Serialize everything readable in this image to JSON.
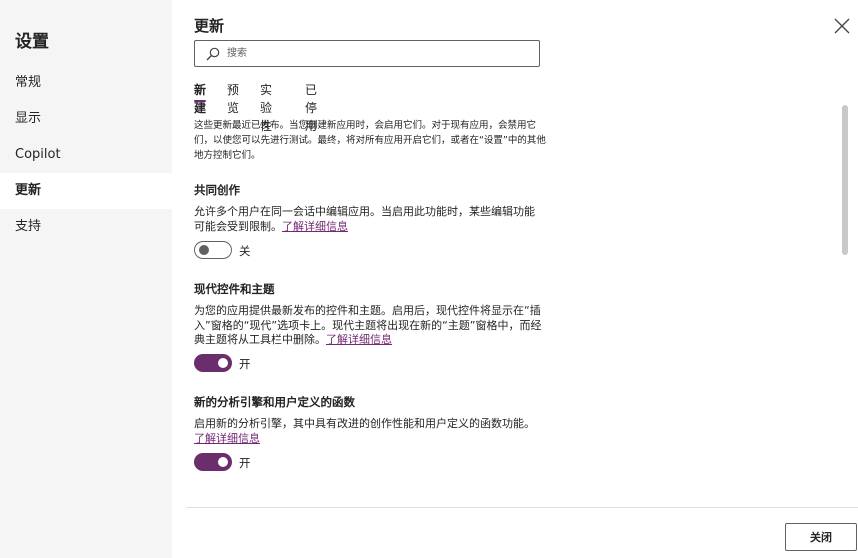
{
  "sidebar": {
    "title": "设置",
    "items": [
      {
        "label": "常规"
      },
      {
        "label": "显示"
      },
      {
        "label": "Copilot"
      },
      {
        "label": "更新"
      },
      {
        "label": "支持"
      }
    ],
    "active_index": 3
  },
  "main": {
    "title": "更新",
    "search_placeholder": "搜索",
    "tabs": [
      {
        "label": "新建"
      },
      {
        "label": "预览"
      },
      {
        "label": "实验性"
      },
      {
        "label": "已停用"
      }
    ],
    "active_tab": 0,
    "intro": "这些更新最近已发布。当您创建新应用时，会启用它们。对于现有应用，会禁用它们，以使您可以先进行测试。最终，将对所有应用开启它们，或者在“设置”中的其他地方控制它们。",
    "learn_more": "了解详细信息",
    "sections": [
      {
        "title": "共同创作",
        "description": "允许多个用户在同一会话中编辑应用。当启用此功能时，某些编辑功能可能会受到限制。",
        "toggle_on": false,
        "toggle_label": "关"
      },
      {
        "title": "现代控件和主题",
        "description": "为您的应用提供最新发布的控件和主题。启用后，现代控件将显示在“插入”窗格的“现代”选项卡上。现代主题将出现在新的“主题”窗格中，而经典主题将从工具栏中删除。",
        "toggle_on": true,
        "toggle_label": "开"
      },
      {
        "title": "新的分析引擎和用户定义的函数",
        "description": "启用新的分析引擎，其中具有改进的创作性能和用户定义的函数功能。",
        "toggle_on": true,
        "toggle_label": "开"
      }
    ]
  },
  "footer": {
    "close_label": "关闭"
  },
  "colors": {
    "accent": "#6b2d6b",
    "link": "#742774",
    "sidebar_bg": "#f5f5f5"
  }
}
